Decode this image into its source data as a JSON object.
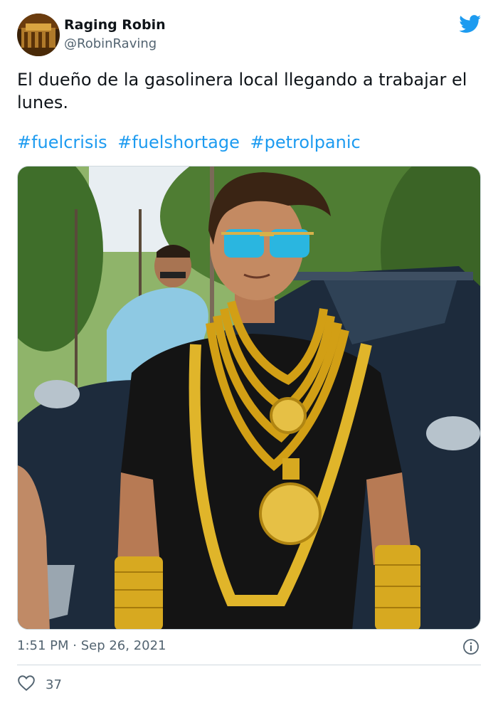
{
  "author": {
    "display_name": "Raging Robin",
    "handle": "@RobinRaving",
    "avatar_icon": "profile-avatar"
  },
  "platform_icon": "twitter-bird-icon",
  "colors": {
    "link": "#1d9bf0",
    "secondary_text": "#536471",
    "brand": "#1d9bf0"
  },
  "tweet": {
    "text": "El dueño de la gasolinera local llegando a trabajar el lunes.",
    "hashtags": [
      "#fuelcrisis",
      "#fuelshortage",
      "#petrolpanic"
    ]
  },
  "media": {
    "description_icon": "tweet-photo"
  },
  "meta": {
    "timestamp": "1:51 PM · Sep 26, 2021"
  },
  "actions": {
    "like_count": "37"
  }
}
